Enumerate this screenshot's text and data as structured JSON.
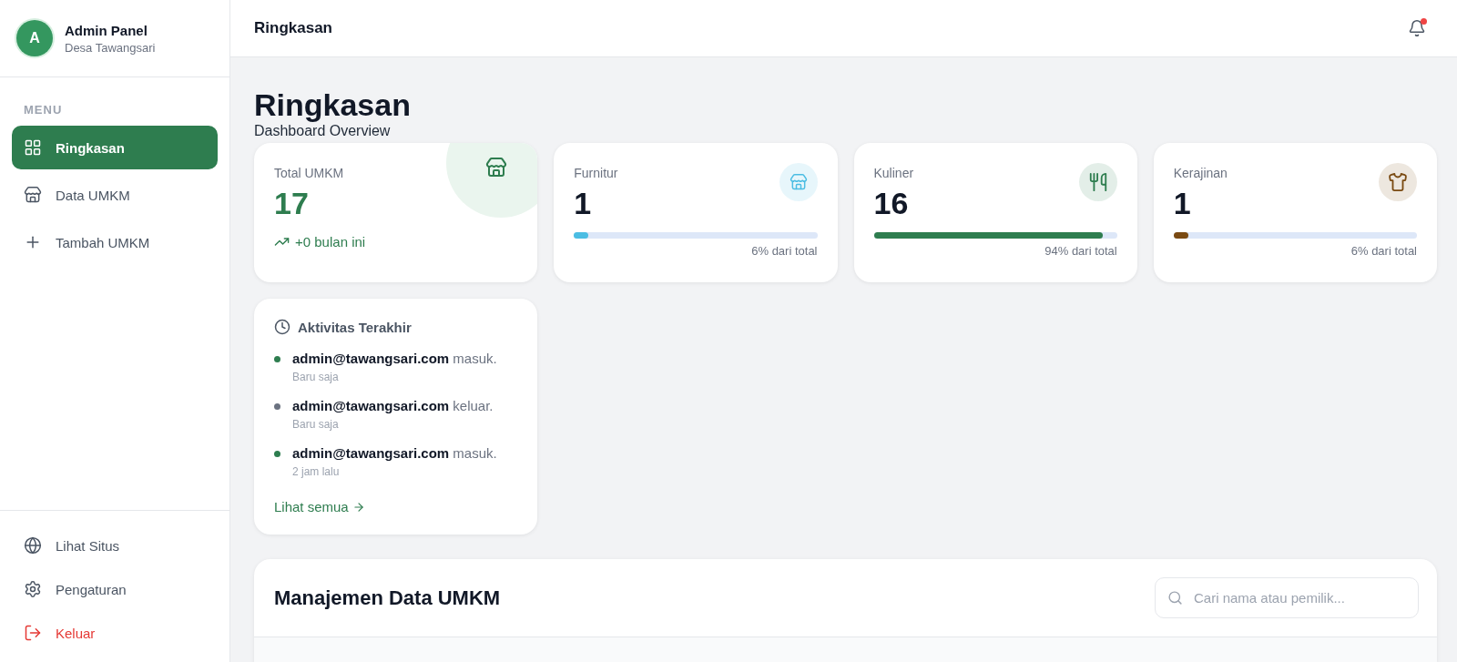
{
  "sidebar": {
    "avatar": "A",
    "title": "Admin Panel",
    "subtitle": "Desa Tawangsari",
    "section_label": "MENU",
    "items": [
      {
        "label": "Ringkasan",
        "kind": "grid",
        "selected": true
      },
      {
        "label": "Data UMKM",
        "kind": "store",
        "selected": false
      },
      {
        "label": "Tambah UMKM",
        "kind": "plus",
        "selected": false
      }
    ],
    "footer_items": [
      {
        "label": "Lihat Situs",
        "kind": "globe"
      },
      {
        "label": "Pengaturan",
        "kind": "settings"
      },
      {
        "label": "Keluar",
        "kind": "logout"
      }
    ]
  },
  "header": {
    "title": "Ringkasan",
    "has_unread": true
  },
  "page": {
    "title": "Ringkasan",
    "subtitle": "Dashboard Overview"
  },
  "total": {
    "label": "Total UMKM",
    "value": "17",
    "trend": "+0 bulan ini"
  },
  "categories": [
    {
      "label": "Furnitur",
      "value": "1",
      "level": 0.06,
      "caption": "6% dari total",
      "color": "#4bbde3",
      "kind": "store"
    },
    {
      "label": "Kuliner",
      "value": "16",
      "level": 0.94,
      "caption": "94% dari total",
      "color": "#2e7d4f",
      "kind": "utensils"
    },
    {
      "label": "Kerajinan",
      "value": "1",
      "level": 0.06,
      "caption": "6% dari total",
      "color": "#7a4a12",
      "kind": "shirt"
    }
  ],
  "activity": {
    "title": "Aktivitas Terakhir",
    "items": [
      {
        "email": "admin@tawangsari.com",
        "action": "masuk.",
        "time": "Baru saja",
        "color": "#2e7d4f"
      },
      {
        "email": "admin@tawangsari.com",
        "action": "keluar.",
        "time": "Baru saja",
        "color": "#6b7280"
      },
      {
        "email": "admin@tawangsari.com",
        "action": "masuk.",
        "time": "2 jam lalu",
        "color": "#2e7d4f"
      }
    ],
    "link": "Lihat semua"
  },
  "table": {
    "title": "Manajemen Data UMKM",
    "search": {
      "placeholder": "Cari nama atau pemilik..."
    }
  }
}
